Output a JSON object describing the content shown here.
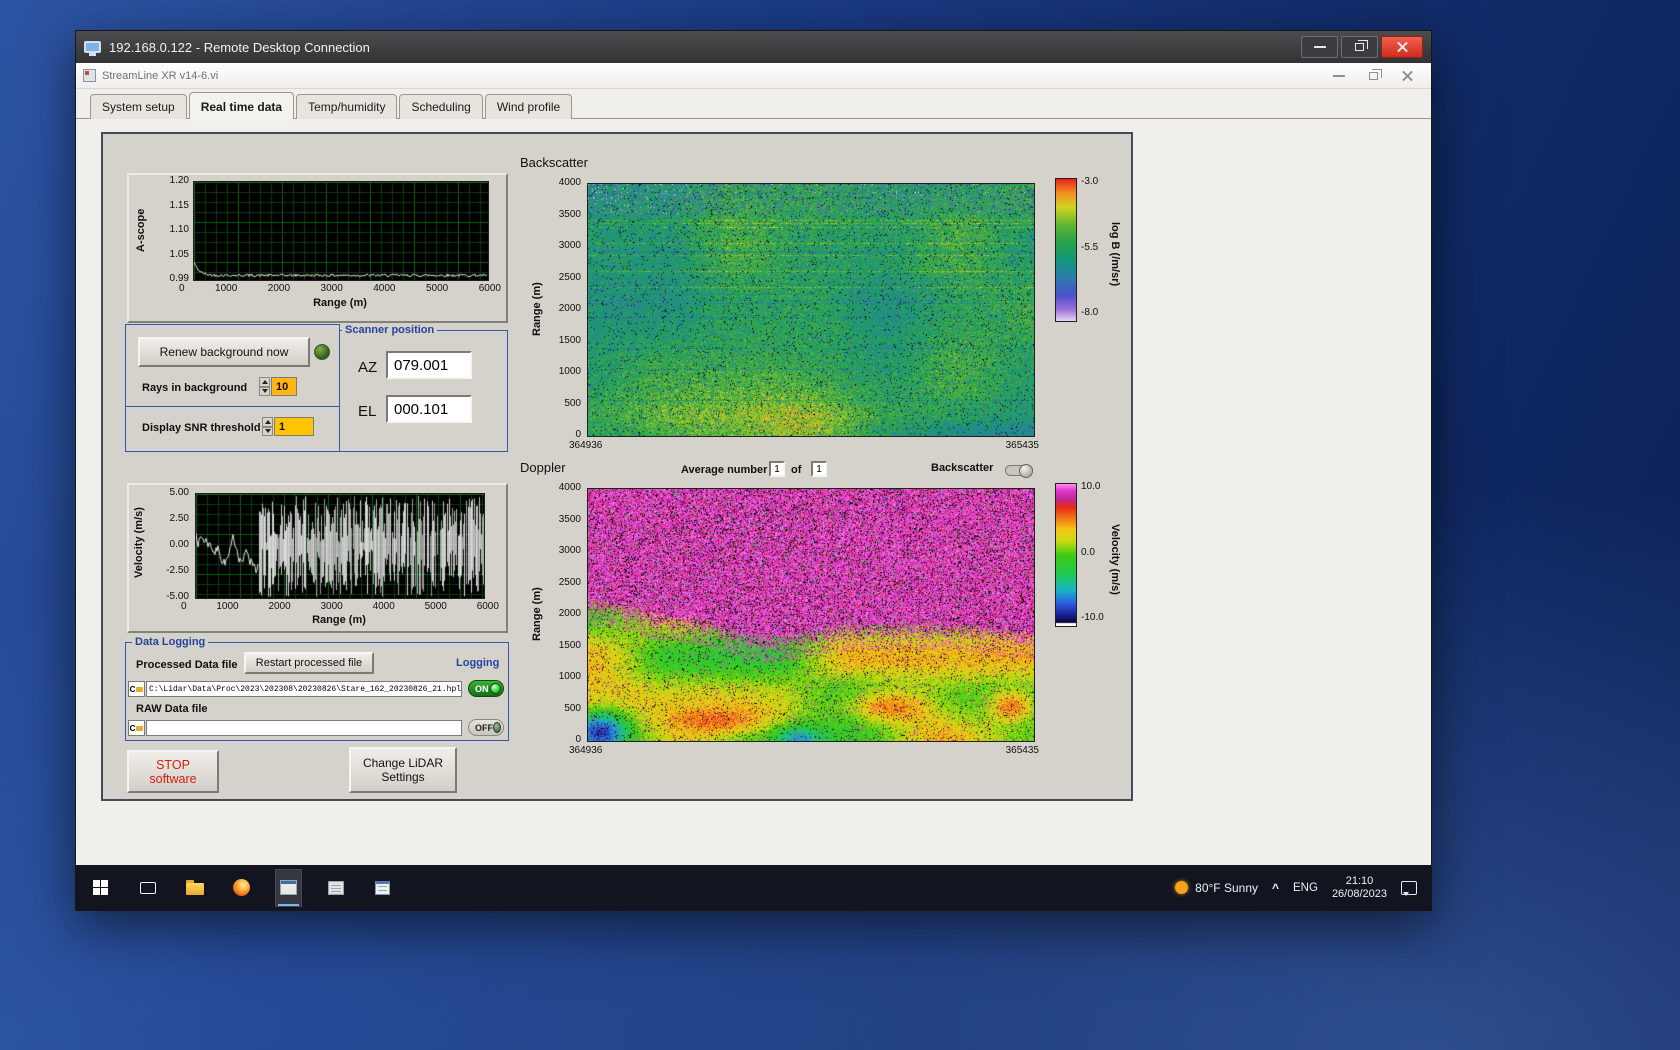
{
  "rdp": {
    "title": "192.168.0.122 - Remote Desktop Connection"
  },
  "app": {
    "title": "StreamLine XR v14-6.vi",
    "tabs": [
      "System setup",
      "Real time data",
      "Temp/humidity",
      "Scheduling",
      "Wind profile"
    ],
    "active_tab": "Real time data"
  },
  "background_controls": {
    "renew_button": "Renew background now",
    "rays_label": "Rays in background",
    "rays_value": "10",
    "snr_label": "Display SNR threshold",
    "snr_value": "1"
  },
  "scanner": {
    "title": "Scanner position",
    "az_label": "AZ",
    "az_value": "079.001",
    "el_label": "EL",
    "el_value": "000.101"
  },
  "logging": {
    "title": "Data Logging",
    "processed_label": "Processed Data file",
    "restart_button": "Restart processed file",
    "logging_label": "Logging",
    "drive_label": "C",
    "processed_path": "C:\\Lidar\\Data\\Proc\\2023\\202308\\20230826\\Stare_162_20230826_21.hpl",
    "raw_label": "RAW Data file",
    "raw_path": "",
    "on_label": "ON",
    "off_label": "OFF"
  },
  "footer_buttons": {
    "stop_line1": "STOP",
    "stop_line2": "software",
    "change_line1": "Change LiDAR",
    "change_line2": "Settings"
  },
  "doppler_bar": {
    "avg_label": "Average number",
    "avg_value": "1",
    "of_label": "of",
    "count_value": "1",
    "backscatter_label": "Backscatter"
  },
  "taskbar": {
    "weather_temp": "80°F Sunny",
    "tray_chevron": "^",
    "language": "ENG",
    "time": "21:10",
    "date": "26/08/2023"
  },
  "colors": {
    "accent_blue_label": "#2444a0",
    "led_green": "#35d23c",
    "value_orange": "#ffb514",
    "value_amber": "#ffc400",
    "stop_red": "#d81c10",
    "close_red": "#e24b3c"
  },
  "chart_data": [
    {
      "id": "a-scope",
      "type": "line",
      "ylabel": "A-scope",
      "xlabel": "Range (m)",
      "yticks": [
        "1.20",
        "1.15",
        "1.10",
        "1.05",
        "0.99"
      ],
      "xticks": [
        "0",
        "1000",
        "2000",
        "3000",
        "4000",
        "5000",
        "6000"
      ],
      "ylim": [
        0.99,
        1.2
      ],
      "xlim": [
        0,
        6000
      ],
      "grid": "fine green mesh on black",
      "series": [
        {
          "name": "a-scope trace",
          "baseline": 1.0,
          "noise_amplitude": 0.004,
          "shape": "flat noisy baseline near 1.00 with small spike to ~1.03 at range 0"
        }
      ]
    },
    {
      "id": "velocity",
      "type": "line",
      "ylabel": "Velocity (m/s)",
      "xlabel": "Range (m)",
      "yticks": [
        "5.00",
        "2.50",
        "0.00",
        "-2.50",
        "-5.00"
      ],
      "xticks": [
        "0",
        "1000",
        "2000",
        "3000",
        "4000",
        "5000",
        "6000"
      ],
      "ylim": [
        -5,
        5
      ],
      "xlim": [
        0,
        6000
      ],
      "grid": "fine green mesh on black",
      "series": [
        {
          "name": "velocity trace",
          "shape": "coherent ±4 m/s trace from 0-1300 m, uncorrelated full-scale noise bars from 1300-6000 m"
        }
      ]
    },
    {
      "id": "backscatter",
      "type": "heatmap",
      "title": "Backscatter",
      "ylabel": "Range (m)",
      "yticks": [
        "4000",
        "3500",
        "3000",
        "2500",
        "2000",
        "1500",
        "1000",
        "500",
        "0"
      ],
      "ylim": [
        0,
        4000
      ],
      "x_start_label": "364936",
      "x_end_label": "365435",
      "colorbar": {
        "label": "log B (/m/sr)",
        "ticks": [
          "-3.0",
          "-5.5",
          "-8.0"
        ],
        "max": -3.0,
        "min": -8.0
      },
      "palette": [
        [
          0,
          "#e0d2f2"
        ],
        [
          0.08,
          "#9b6fd8"
        ],
        [
          0.18,
          "#4b52cc"
        ],
        [
          0.3,
          "#2e7ab0"
        ],
        [
          0.42,
          "#14967e"
        ],
        [
          0.55,
          "#27a14d"
        ],
        [
          0.68,
          "#5fb832"
        ],
        [
          0.8,
          "#cfd420"
        ],
        [
          0.9,
          "#f59322"
        ],
        [
          1,
          "#e82820"
        ]
      ],
      "content": "speckled teal/green aerosol backscatter at all ranges, occasional bright horizontal streaks, bright green plume below ~700 m left of centre, darker blue band near 0 m"
    },
    {
      "id": "doppler",
      "type": "heatmap",
      "title": "Doppler",
      "ylabel": "Range (m)",
      "yticks": [
        "4000",
        "3500",
        "3000",
        "2500",
        "2000",
        "1500",
        "1000",
        "500",
        "0"
      ],
      "ylim": [
        0,
        4000
      ],
      "x_start_label": "364936",
      "x_end_label": "365435",
      "colorbar": {
        "label": "Velocity (m/s)",
        "ticks": [
          "10.0",
          "0.0",
          "-10.0"
        ],
        "max": 10.0,
        "min": -10.0
      },
      "palette": [
        [
          0,
          "#06060c"
        ],
        [
          0.07,
          "#1a1a8c"
        ],
        [
          0.15,
          "#2a5ae0"
        ],
        [
          0.25,
          "#19b4c8"
        ],
        [
          0.35,
          "#1ec85a"
        ],
        [
          0.5,
          "#3ecc10"
        ],
        [
          0.6,
          "#c8dc14"
        ],
        [
          0.68,
          "#f5c814"
        ],
        [
          0.76,
          "#f07818"
        ],
        [
          0.84,
          "#e62818"
        ],
        [
          0.9,
          "#c02898"
        ],
        [
          0.96,
          "#e53ad4"
        ],
        [
          1,
          "#ff8af0"
        ]
      ],
      "content": "magenta uncorrelated noise above the boundary layer (~1500-2000 m), green/yellow velocity field below with red patches between 300-1200 m"
    }
  ]
}
